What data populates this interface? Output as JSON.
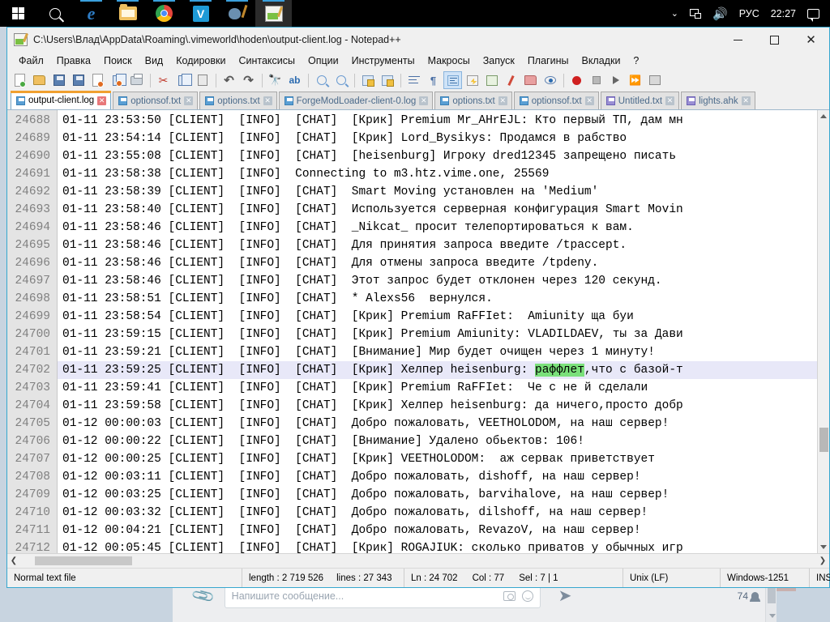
{
  "taskbar": {
    "icons": [
      {
        "name": "start-button",
        "label": "Start"
      },
      {
        "name": "search-icon",
        "label": "Search"
      },
      {
        "name": "edge-icon",
        "label": "Microsoft Edge"
      },
      {
        "name": "file-explorer-icon",
        "label": "File Explorer"
      },
      {
        "name": "chrome-icon",
        "label": "Google Chrome"
      },
      {
        "name": "vimeworld-icon",
        "label": "V"
      },
      {
        "name": "paint-icon",
        "label": "Paint"
      },
      {
        "name": "notepadpp-taskbar-icon",
        "label": "Notepad++"
      }
    ],
    "tray": {
      "chevron": "⌄",
      "language": "РУС",
      "clock": "22:27"
    }
  },
  "window": {
    "title": "C:\\Users\\Влад\\AppData\\Roaming\\.vimeworld\\hoden\\output-client.log - Notepad++",
    "controls": {
      "minimize": "–",
      "maximize": "□",
      "close": "✕"
    }
  },
  "menu": {
    "items": [
      "Файл",
      "Правка",
      "Поиск",
      "Вид",
      "Кодировки",
      "Синтаксисы",
      "Опции",
      "Инструменты",
      "Макросы",
      "Запуск",
      "Плагины",
      "Вкладки",
      "?"
    ]
  },
  "tabs": [
    {
      "label": "output-client.log",
      "active": true,
      "color": "blue"
    },
    {
      "label": "optionsof.txt",
      "active": false,
      "color": "blue"
    },
    {
      "label": "options.txt",
      "active": false,
      "color": "blue"
    },
    {
      "label": "ForgeModLoader-client-0.log",
      "active": false,
      "color": "blue"
    },
    {
      "label": "options.txt",
      "active": false,
      "color": "blue"
    },
    {
      "label": "optionsof.txt",
      "active": false,
      "color": "blue"
    },
    {
      "label": "Untitled.txt",
      "active": false,
      "color": "purple"
    },
    {
      "label": "lights.ahk",
      "active": false,
      "color": "purple"
    }
  ],
  "editor": {
    "selection_highlight_color": "#7ae07a",
    "current_line_color": "#e8e8f8",
    "lines": [
      {
        "n": "24688",
        "pre": "01-11 23:53:50 [CLIENT]  [INFO]  [CHAT]  [Крик] Premium Mr_AHrEJL: Кто первый ТП, дам мн"
      },
      {
        "n": "24689",
        "pre": "01-11 23:54:14 [CLIENT]  [INFO]  [CHAT]  [Крик] Lord_Bysikys: Продамся в рабство"
      },
      {
        "n": "24690",
        "pre": "01-11 23:55:08 [CLIENT]  [INFO]  [CHAT]  [heisenburg] Игроку dred12345 запрещено писать"
      },
      {
        "n": "24691",
        "pre": "01-11 23:58:38 [CLIENT]  [INFO]  Connecting to m3.htz.vime.one, 25569"
      },
      {
        "n": "24692",
        "pre": "01-11 23:58:39 [CLIENT]  [INFO]  [CHAT]  Smart Moving установлен на 'Medium'"
      },
      {
        "n": "24693",
        "pre": "01-11 23:58:40 [CLIENT]  [INFO]  [CHAT]  Используется серверная конфигурация Smart Movin"
      },
      {
        "n": "24694",
        "pre": "01-11 23:58:46 [CLIENT]  [INFO]  [CHAT]  _Nikcat_ просит телепортироваться к вам."
      },
      {
        "n": "24695",
        "pre": "01-11 23:58:46 [CLIENT]  [INFO]  [CHAT]  Для принятия запроса введите /tpaccept."
      },
      {
        "n": "24696",
        "pre": "01-11 23:58:46 [CLIENT]  [INFO]  [CHAT]  Для отмены запроса введите /tpdeny."
      },
      {
        "n": "24697",
        "pre": "01-11 23:58:46 [CLIENT]  [INFO]  [CHAT]  Этот запрос будет отклонен через 120 секунд."
      },
      {
        "n": "24698",
        "pre": "01-11 23:58:51 [CLIENT]  [INFO]  [CHAT]  * Alexs56  вернулся."
      },
      {
        "n": "24699",
        "pre": "01-11 23:58:54 [CLIENT]  [INFO]  [CHAT]  [Крик] Premium RaFFIet:  Amiunity ща буи"
      },
      {
        "n": "24700",
        "pre": "01-11 23:59:15 [CLIENT]  [INFO]  [CHAT]  [Крик] Premium Amiunity: VLADILDAEV, ты за Дави"
      },
      {
        "n": "24701",
        "pre": "01-11 23:59:21 [CLIENT]  [INFO]  [CHAT]  [Внимание] Мир будет очищен через 1 минуту!"
      },
      {
        "n": "24702",
        "pre": "01-11 23:59:25 [CLIENT]  [INFO]  [CHAT]  [Крик] Хелпер heisenburg: ",
        "hl": "раффлет",
        "post": ",что с базой-т",
        "current": true
      },
      {
        "n": "24703",
        "pre": "01-11 23:59:41 [CLIENT]  [INFO]  [CHAT]  [Крик] Premium RaFFIet:  Че с не й сделали"
      },
      {
        "n": "24704",
        "pre": "01-11 23:59:58 [CLIENT]  [INFO]  [CHAT]  [Крик] Хелпер heisenburg: да ничего,просто добр"
      },
      {
        "n": "24705",
        "pre": "01-12 00:00:03 [CLIENT]  [INFO]  [CHAT]  Добро пожаловать, VEETHOLODOM, на наш сервер!"
      },
      {
        "n": "24706",
        "pre": "01-12 00:00:22 [CLIENT]  [INFO]  [CHAT]  [Внимание] Удалено обьектов: 106!"
      },
      {
        "n": "24707",
        "pre": "01-12 00:00:25 [CLIENT]  [INFO]  [CHAT]  [Крик] VEETHOLODOM:  аж сервак приветствует"
      },
      {
        "n": "24708",
        "pre": "01-12 00:03:11 [CLIENT]  [INFO]  [CHAT]  Добро пожаловать, dishoff, на наш сервер!"
      },
      {
        "n": "24709",
        "pre": "01-12 00:03:25 [CLIENT]  [INFO]  [CHAT]  Добро пожаловать, barvihalove, на наш сервер!"
      },
      {
        "n": "24710",
        "pre": "01-12 00:03:32 [CLIENT]  [INFO]  [CHAT]  Добро пожаловать, dilshoff, на наш сервер!"
      },
      {
        "n": "24711",
        "pre": "01-12 00:04:21 [CLIENT]  [INFO]  [CHAT]  Добро пожаловать, RevazoV, на наш сервер!"
      },
      {
        "n": "24712",
        "pre": "01-12 00:05:45 [CLIENT]  [INFO]  [CHAT]  [Крик] ROGAJIUK: сколько приватов у обычных игр"
      }
    ]
  },
  "statusbar": {
    "file_type": "Normal text file",
    "length_label": "length : 2 719 526",
    "lines_label": "lines : 27 343",
    "ln": "Ln : 24 702",
    "col": "Col : 77",
    "sel": "Sel : 7 | 1",
    "eol": "Unix (LF)",
    "encoding": "Windows-1251",
    "insert_mode": "INS"
  },
  "messenger": {
    "placeholder": "Напишите сообщение...",
    "member_count": "74"
  }
}
